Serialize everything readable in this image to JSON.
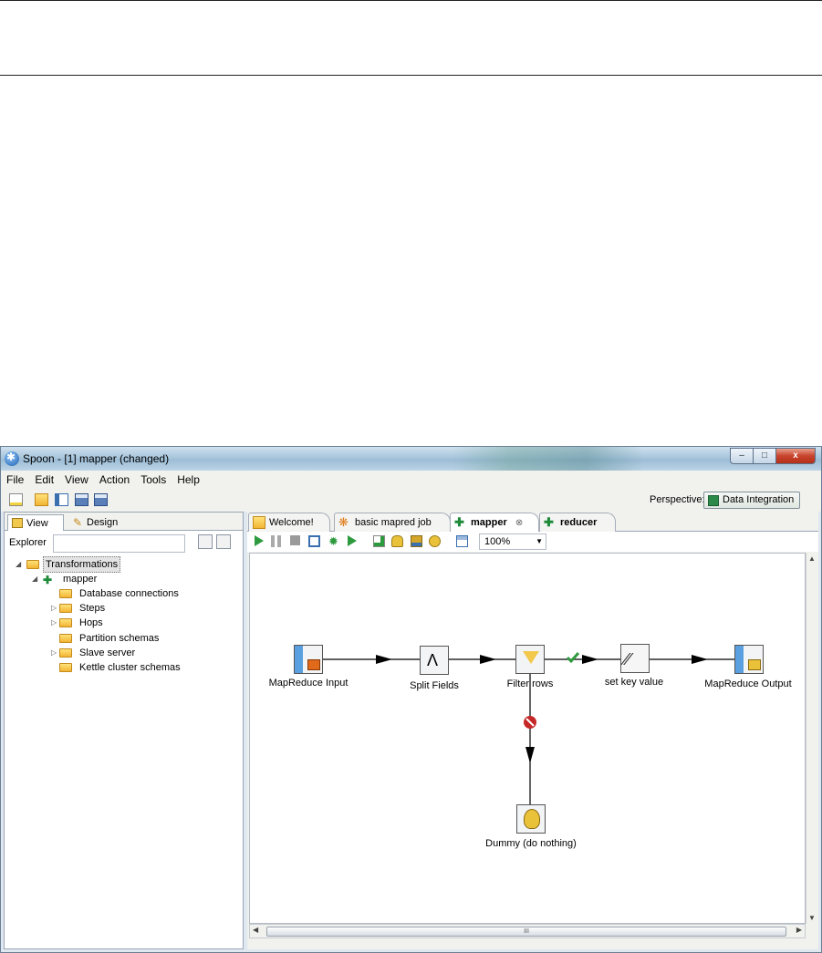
{
  "window": {
    "title": "Spoon - [1] mapper (changed)"
  },
  "window_buttons": {
    "minimize": "–",
    "maximize": "□",
    "close": "x"
  },
  "menu": [
    "File",
    "Edit",
    "View",
    "Action",
    "Tools",
    "Help"
  ],
  "perspective": {
    "label": "Perspective:",
    "value": "Data Integration"
  },
  "left_tabs": {
    "view": "View",
    "design": "Design"
  },
  "explorer": {
    "label": "Explorer",
    "value": ""
  },
  "tree": {
    "root": "Transformations",
    "transformation": "mapper",
    "items": [
      "Database connections",
      "Steps",
      "Hops",
      "Partition schemas",
      "Slave server",
      "Kettle cluster schemas"
    ]
  },
  "editor_tabs": [
    "Welcome!",
    "basic mapred job",
    "mapper",
    "reducer"
  ],
  "zoom": "100%",
  "steps": {
    "mapreduce_input": "MapReduce Input",
    "split_fields": "Split Fields",
    "filter_rows": "Filter rows",
    "set_key_value": "set key value",
    "mapreduce_output": "MapReduce Output",
    "dummy": "Dummy (do nothing)"
  },
  "scroll_grip": "III",
  "colors": {
    "accent": "#1f8b3a",
    "error_hop": "#c62828",
    "ok_hop": "#2e9a3e"
  }
}
